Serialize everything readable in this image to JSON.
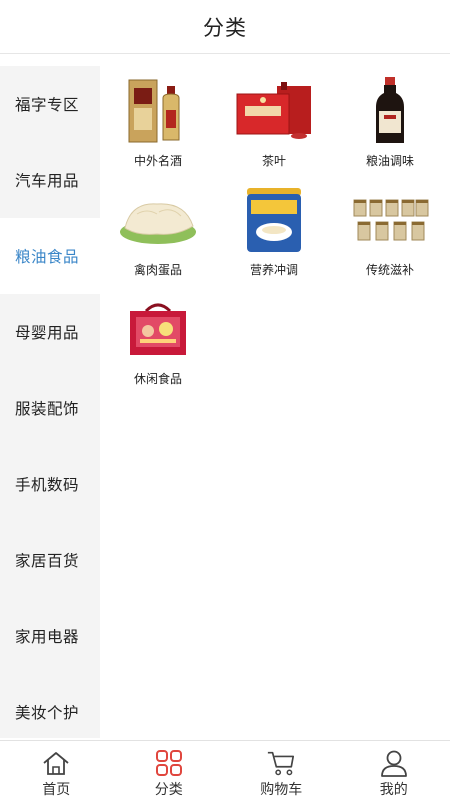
{
  "header": {
    "title": "分类"
  },
  "sidebar": {
    "items": [
      {
        "label": "福字专区",
        "active": false
      },
      {
        "label": "汽车用品",
        "active": false
      },
      {
        "label": "粮油食品",
        "active": true
      },
      {
        "label": "母婴用品",
        "active": false
      },
      {
        "label": "服装配饰",
        "active": false
      },
      {
        "label": "手机数码",
        "active": false
      },
      {
        "label": "家居百货",
        "active": false
      },
      {
        "label": "家用电器",
        "active": false
      },
      {
        "label": "美妆个护",
        "active": false
      }
    ]
  },
  "categories": [
    {
      "label": "中外名酒",
      "icon": "liquor-bottle-box-image"
    },
    {
      "label": "茶叶",
      "icon": "tea-gift-box-image"
    },
    {
      "label": "粮油调味",
      "icon": "soy-sauce-bottle-image"
    },
    {
      "label": "禽肉蛋品",
      "icon": "poultry-meat-image"
    },
    {
      "label": "营养冲调",
      "icon": "milk-powder-can-image"
    },
    {
      "label": "传统滋补",
      "icon": "tonic-jars-image"
    },
    {
      "label": "休闲食品",
      "icon": "snack-gift-box-image"
    }
  ],
  "tabbar": {
    "items": [
      {
        "label": "首页",
        "icon": "home-icon",
        "active": false
      },
      {
        "label": "分类",
        "icon": "category-grid-icon",
        "active": true
      },
      {
        "label": "购物车",
        "icon": "cart-icon",
        "active": false
      },
      {
        "label": "我的",
        "icon": "user-icon",
        "active": false
      }
    ]
  },
  "colors": {
    "active_sidebar_text": "#3a86c8",
    "active_tab_icon": "#e0463e",
    "sidebar_bg": "#f4f4f4"
  }
}
